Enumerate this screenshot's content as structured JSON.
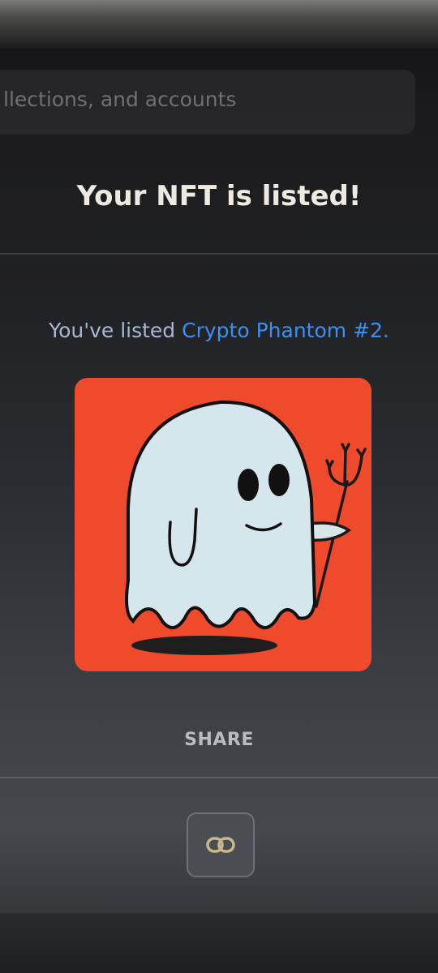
{
  "search": {
    "text": "llections, and accounts"
  },
  "modal": {
    "title": "Your NFT is listed!",
    "listed_prefix": "You've listed ",
    "nft_name": "Crypto Phantom #2",
    "listed_suffix": "."
  },
  "nft_image": {
    "description_icon": "ghost-devil-nft",
    "background_color": "#f04a2c"
  },
  "share": {
    "label": "SHARE",
    "copy_link_icon": "link-icon"
  },
  "colors": {
    "accent_link": "#3d8ff0",
    "title_text": "#eeeae2"
  }
}
